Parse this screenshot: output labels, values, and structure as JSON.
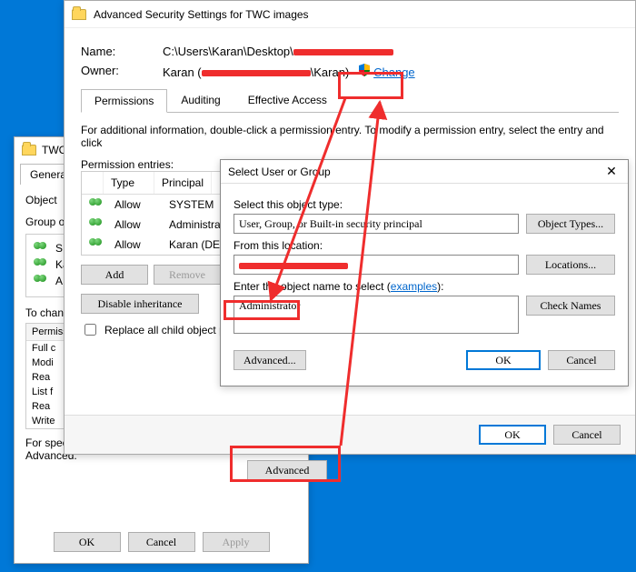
{
  "props": {
    "title": "TWC",
    "tabs": {
      "general": "General"
    },
    "objectLabel": "Object",
    "groupLabel": "Group or user names:",
    "users": [
      "SYSTEM",
      "Karan",
      "Administrators"
    ],
    "usersShort": [
      "S",
      "Ka",
      "A"
    ],
    "changeHint": "To change",
    "permForHdr": "Permissions",
    "permCols": {
      "c1": "Permissions for SYSTEM"
    },
    "perms": [
      "Full control",
      "Modify",
      "Read & execute",
      "List folder contents",
      "Read",
      "Write"
    ],
    "permsShort": [
      "Full c",
      "Modi",
      "Rea",
      "List f",
      "Rea",
      "Write"
    ],
    "specialNote": "For special permissions or advanced settings, click Advanced.",
    "advancedBtn": "Advanced",
    "ok": "OK",
    "cancel": "Cancel",
    "apply": "Apply"
  },
  "adv": {
    "title": "Advanced Security Settings for TWC images",
    "nameLabel": "Name:",
    "nameValue": "C:\\Users\\Karan\\Desktop\\",
    "ownerLabel": "Owner:",
    "ownerValue": "Karan (",
    "ownerSuffix": "\\Karan)",
    "changeLink": "Change",
    "tabs": {
      "perm": "Permissions",
      "aud": "Auditing",
      "eff": "Effective Access"
    },
    "info": "For additional information, double-click a permission entry. To modify a permission entry, select the entry and click",
    "entriesLabel": "Permission entries:",
    "cols": {
      "type": "Type",
      "prin": "Principal"
    },
    "rows": [
      {
        "type": "Allow",
        "prin": "SYSTEM"
      },
      {
        "type": "Allow",
        "prin": "Administrators"
      },
      {
        "type": "Allow",
        "prin": "Karan (DESKTOP"
      }
    ],
    "addBtn": "Add",
    "removeBtn": "Remove",
    "disableInh": "Disable inheritance",
    "replaceChk": "Replace all child object permission entries with inheritable permission entries from this object",
    "ok": "OK",
    "cancel": "Cancel"
  },
  "sel": {
    "title": "Select User or Group",
    "typeLabel": "Select this object type:",
    "typeValue": "User, Group, or Built-in security principal",
    "objTypesBtn": "Object Types...",
    "locLabel": "From this location:",
    "locationsBtn": "Locations...",
    "nameLabel": "Enter the object name to select (",
    "examplesLink": "examples",
    "nameLabelEnd": "):",
    "nameValue": "Administrator",
    "checkBtn": "Check Names",
    "advBtn": "Advanced...",
    "ok": "OK",
    "cancel": "Cancel"
  }
}
